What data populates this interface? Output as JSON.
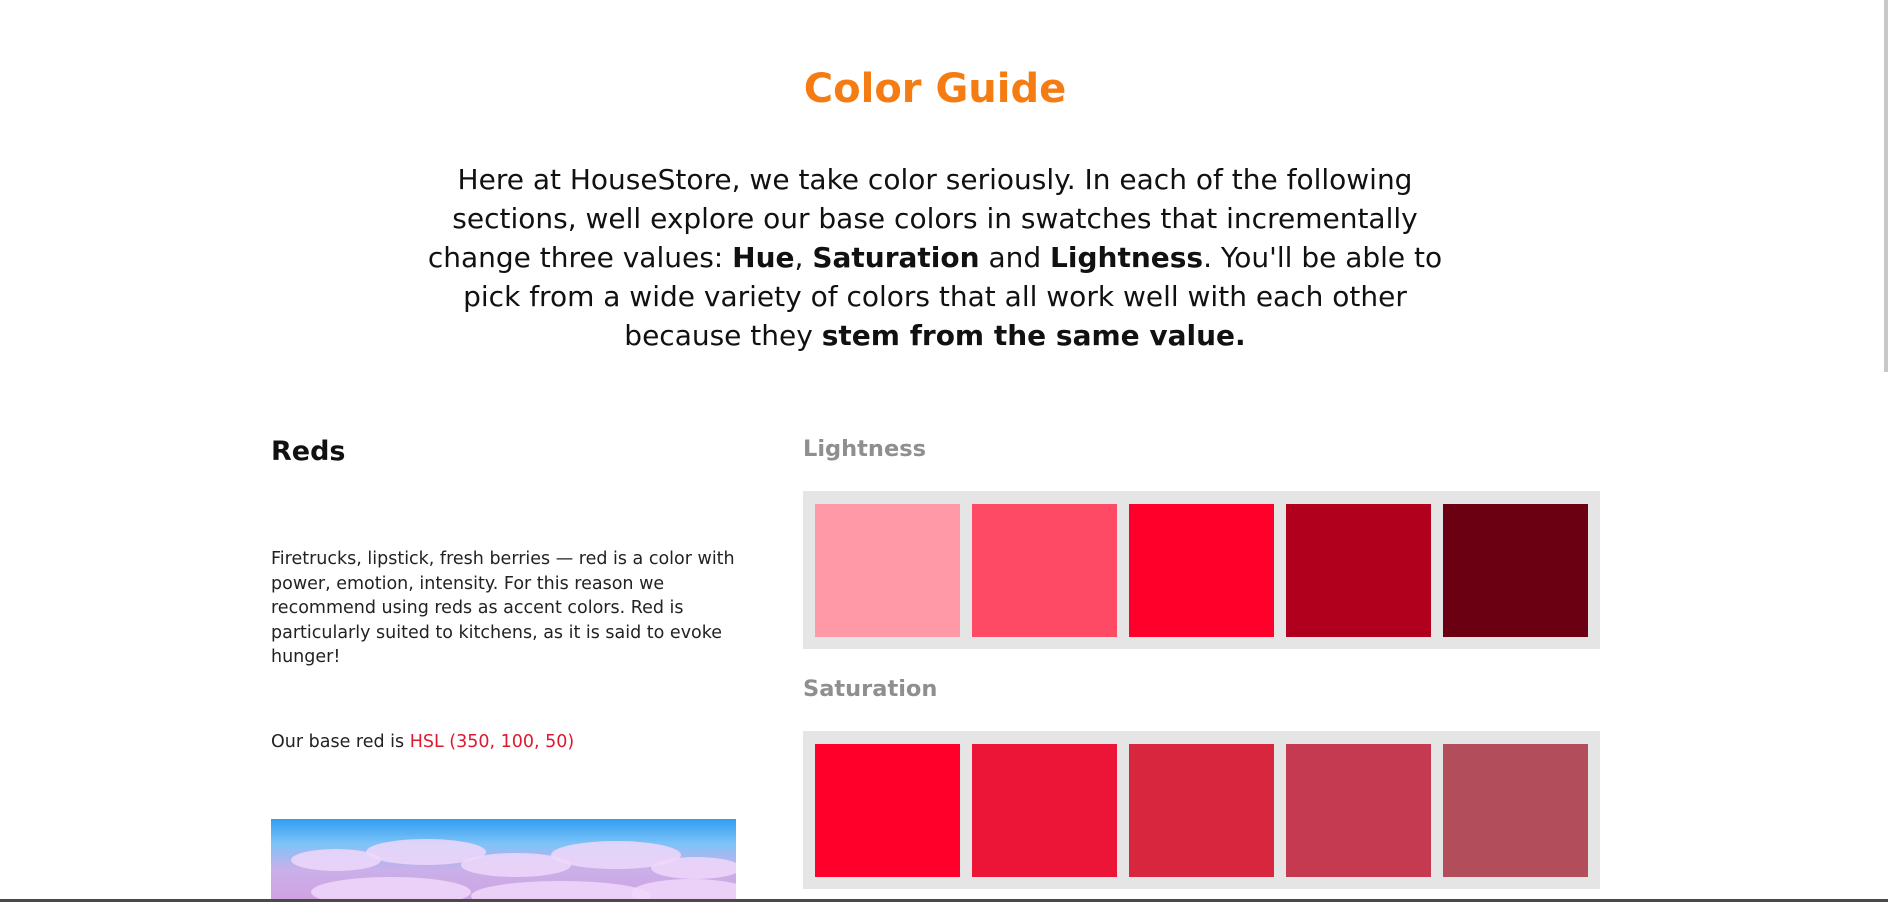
{
  "header": {
    "title": "Color Guide",
    "intro": {
      "p1": "Here at HouseStore, we take color seriously. In each of the following sections, well explore our base colors in swatches that incrementally change three values: ",
      "hue": "Hue",
      "comma": ",",
      "saturation": "Saturation",
      "and": " and ",
      "lightness": "Lightness",
      "p2": ". You'll be able to pick from a wide variety of colors that all work well with each other because they ",
      "stem": "stem from the same value."
    }
  },
  "reds": {
    "heading": "Reds",
    "description": "Firetrucks, lipstick, fresh berries — red is a color with power, emotion, intensity. For this reason we recommend using reds as accent colors. Red is particularly suited to kitchens, as it is said to evoke hunger!",
    "base_prefix": "Our base red is ",
    "base_value": "HSL (350, 100, 50)"
  },
  "lightness": {
    "label": "Lightness",
    "swatches": [
      "#ff99a8",
      "#ff4a65",
      "#ff002b",
      "#b0001e",
      "#6a0012"
    ]
  },
  "saturation": {
    "label": "Saturation",
    "swatches": [
      "#ff002b",
      "#ec1537",
      "#d9263f",
      "#c53a50",
      "#b24e5c"
    ]
  }
}
